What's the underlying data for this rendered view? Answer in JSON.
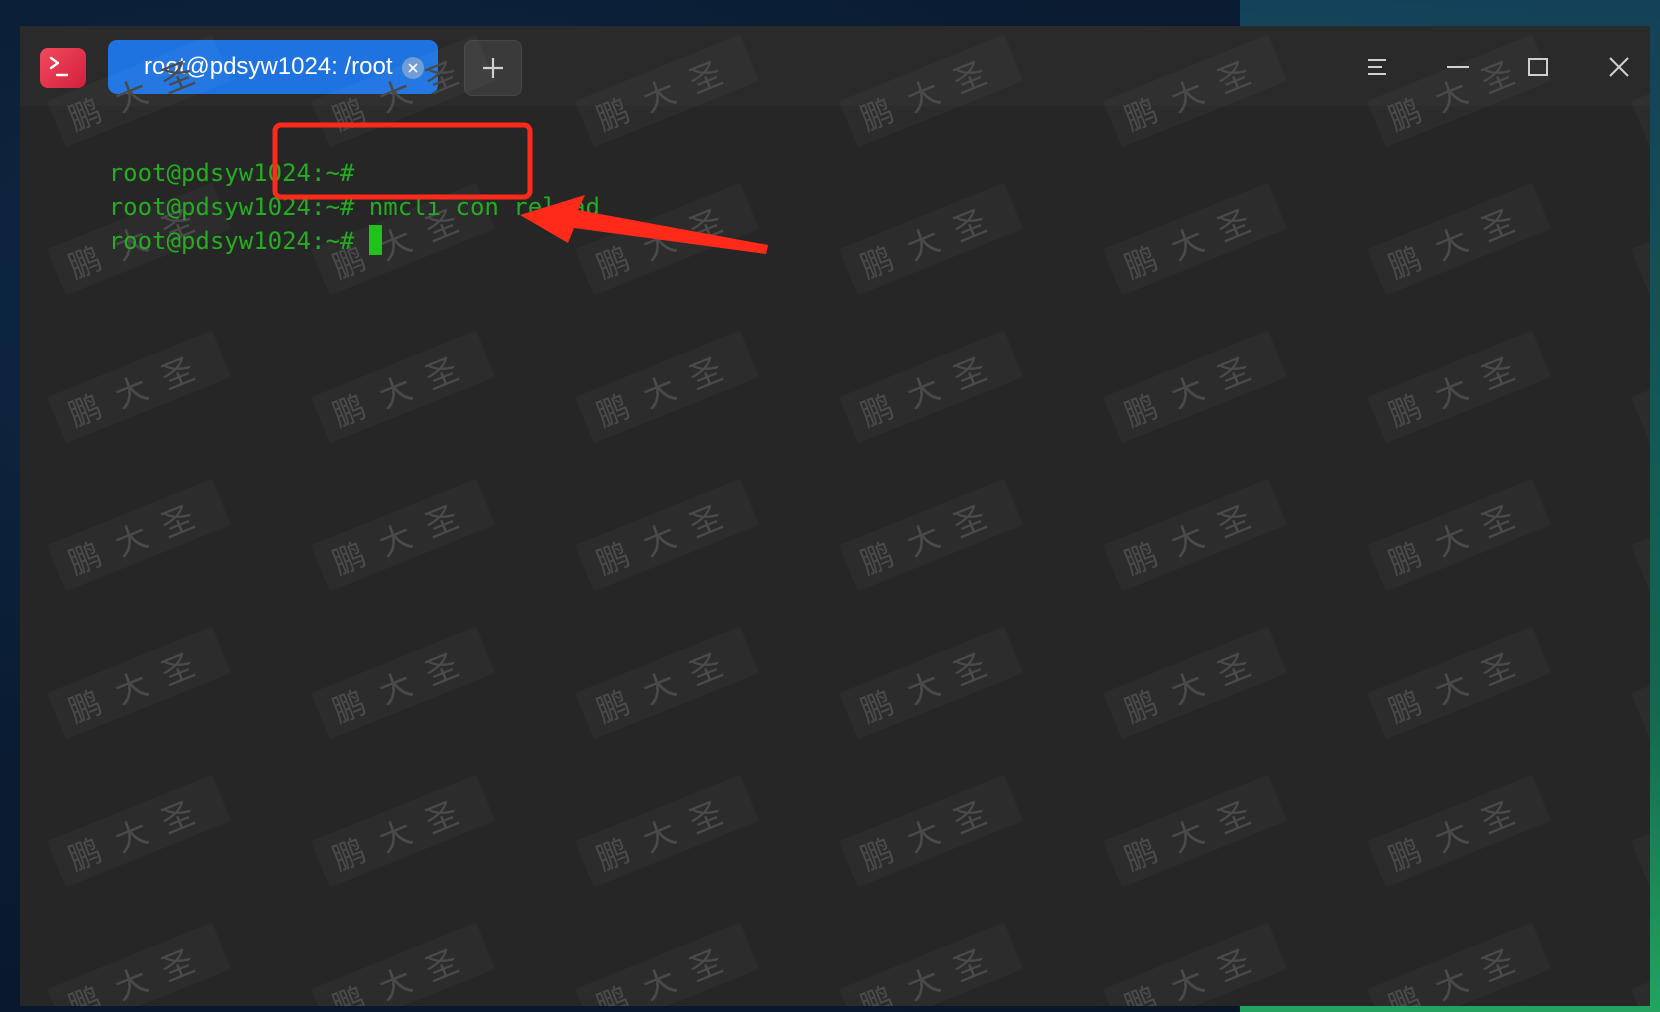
{
  "window": {
    "tab_title": "root@pdsyw1024: /root",
    "add_tab_symbol": "+",
    "accent_color": "#1e73e0"
  },
  "terminal": {
    "prompt": "root@pdsyw1024:~#",
    "lines": [
      {
        "prompt": "root@pdsyw1024:~#",
        "command": ""
      },
      {
        "prompt": "root@pdsyw1024:~#",
        "command": "nmcli con reload"
      },
      {
        "prompt": "root@pdsyw1024:~#",
        "command": ""
      }
    ],
    "text_color": "#23ad1f",
    "background": "#262626"
  },
  "watermark": {
    "text": "鹏大圣"
  },
  "annotation": {
    "color": "#ff2a1a",
    "highlighted_command": "nmcli con reload"
  },
  "icons": [
    "terminal-app-icon",
    "close-tab-icon",
    "plus-icon",
    "menu-icon",
    "minimize-icon",
    "maximize-icon",
    "close-icon"
  ]
}
